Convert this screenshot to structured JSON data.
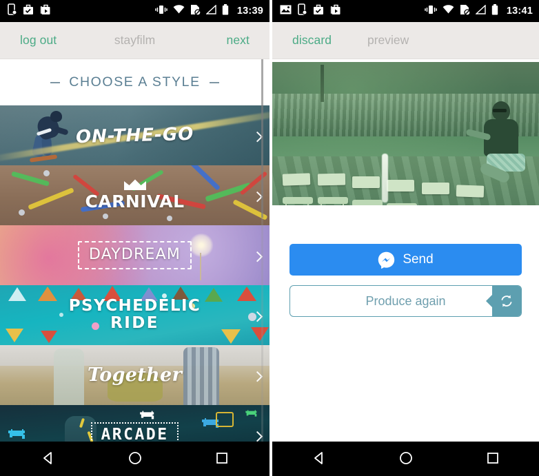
{
  "left_phone": {
    "status_bar": {
      "time": "13:39",
      "left_icons": [
        "phone-sync-icon",
        "briefcase-check-icon",
        "play-store-bag-icon"
      ],
      "right_icons": [
        "vibrate-icon",
        "wifi-icon",
        "sd-card-disabled-icon",
        "signal-icon",
        "battery-icon"
      ]
    },
    "app_bar": {
      "left_action": "log out",
      "brand": "stayfilm",
      "right_action": "next"
    },
    "section_header": "CHOOSE A STYLE",
    "styles": [
      {
        "id": "on-the-go",
        "label": "ON-THE-GO",
        "chevron": "chevron-right-icon"
      },
      {
        "id": "carnival",
        "label": "CARNIVAL",
        "chevron": "chevron-right-icon"
      },
      {
        "id": "daydream",
        "label": "DAYDREAM",
        "chevron": "chevron-right-icon"
      },
      {
        "id": "psychedelic",
        "label": "PSYCHEDELIC",
        "label2": "RIDE",
        "chevron": "chevron-right-icon"
      },
      {
        "id": "together",
        "label": "Together",
        "chevron": "chevron-right-icon"
      },
      {
        "id": "arcade",
        "label": "ARCADE",
        "chevron": "chevron-right-icon"
      }
    ],
    "nav": {
      "back": "back-icon",
      "home": "home-icon",
      "recents": "recents-icon"
    }
  },
  "right_phone": {
    "status_bar": {
      "time": "13:41",
      "left_icons": [
        "image-icon",
        "phone-sync-icon",
        "briefcase-check-icon",
        "play-store-bag-icon"
      ],
      "right_icons": [
        "vibrate-icon",
        "wifi-icon",
        "sd-card-disabled-icon",
        "signal-icon",
        "battery-icon"
      ]
    },
    "app_bar": {
      "left_action": "discard",
      "brand": "preview"
    },
    "video_preview": {
      "name": "video-preview"
    },
    "actions": {
      "send_label": "Send",
      "send_icon": "messenger-icon",
      "produce_label": "Produce again",
      "produce_icon": "refresh-icon"
    },
    "nav": {
      "back": "back-icon",
      "home": "home-icon",
      "recents": "recents-icon"
    }
  },
  "colors": {
    "accent_green": "#4cab86",
    "appbar_bg": "#ece9e7",
    "brand_gray": "#b4b2b0",
    "header_blue": "#5b7f93",
    "send_blue": "#2b8cf0",
    "produce_teal": "#5d9fb0"
  }
}
